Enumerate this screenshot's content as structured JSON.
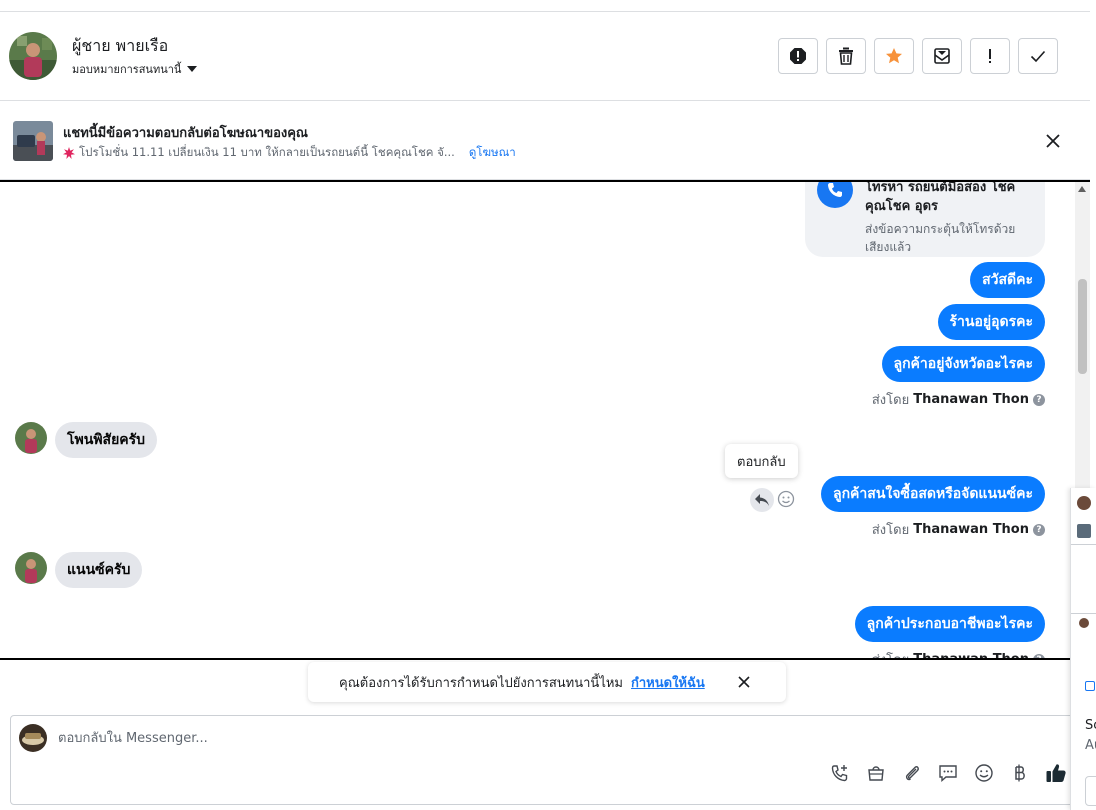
{
  "header": {
    "contact_name": "ผู้ชาย พายเรือ",
    "assign_label": "มอบหมายการสนทนานี้",
    "actions": [
      "spam-icon",
      "trash-icon",
      "star-icon",
      "mark-unread-icon",
      "follow-up-icon",
      "done-icon"
    ],
    "star_color": "#f7923b"
  },
  "ad_banner": {
    "title": "แชทนี้มีข้อความตอบกลับต่อโฆษณาของคุณ",
    "subtitle": "โปรโมชั่น 11.11 เปลี่ยนเงิน 11 บาท ให้กลายเป็นรถยนต์นี้ โชคคุณโชค จั...",
    "link": "ดูโฆษณา"
  },
  "messages": {
    "call_card": {
      "title": "โทรหา รถยนต์มือสอง โชคคุณโชค อุดร",
      "subtitle": "ส่งข้อความกระตุ้นให้โทรด้วยเสียงแล้ว"
    },
    "out1": "สวัสดีคะ",
    "out2": "ร้านอยู่อุดรคะ",
    "out3": "ลูกค้าอยู่จังหวัดอะไรคะ",
    "sent_by_prefix": "ส่งโดย",
    "sender": "Thanawan Thon",
    "in1": "โพนพิสัยครับ",
    "tooltip": "ตอบกลับ",
    "out4": "ลูกค้าสนใจซื้อสดหรือจัดแนนซ์คะ",
    "in2": "แนนซ์ครับ",
    "out5": "ลูกค้าประกอบอาชีพอะไรคะ"
  },
  "notify": {
    "text": "คุณต้องการได้รับการกำหนดไปยังการสนทนานี้ไหม",
    "link": "กำหนดให้ฉัน"
  },
  "composer": {
    "placeholder": "ตอบกลับใน Messenger...",
    "tools": [
      "call-icon",
      "shop-icon",
      "attach-icon",
      "saved-replies-icon",
      "emoji-icon",
      "baht-icon",
      "like-icon"
    ]
  },
  "side_panel": {
    "text1": "Sc",
    "text2": "Au"
  },
  "colors": {
    "accent": "#1877f2",
    "bubble_out": "#0a7cff",
    "bubble_in": "#e4e6eb"
  }
}
